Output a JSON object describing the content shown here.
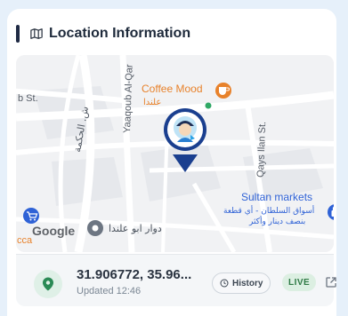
{
  "section": {
    "title": "Location Information",
    "icon": "map-icon"
  },
  "map": {
    "labels": {
      "street_a": "b St.",
      "street_b": "Yaaqoub Al-Qar",
      "street_c": "Qays Ilan St.",
      "street_d": "ش. الحكمة",
      "coffee_name": "Coffee Mood",
      "coffee_ar": "علندا",
      "sultan_name": "Sultan markets",
      "sultan_ar1": "أسواق السلطان - أي قطعة",
      "sultan_ar2": "بنصف دينار وأكثر",
      "roundabout": "دوار ابو علندا",
      "google": "Google",
      "cca": "cca"
    },
    "icons": [
      "coffee-icon",
      "shopping-bag-icon",
      "cart-icon",
      "place-icon",
      "location-marker-icon",
      "avatar"
    ]
  },
  "info": {
    "coordinates": "31.906772, 35.96...",
    "updated": "Updated 12:46",
    "history_label": "History",
    "live_label": "LIVE"
  },
  "colors": {
    "accent": "#1f2a44",
    "marker": "#1a3f8f",
    "live_bg": "#dcefe2",
    "live_text": "#2f7a45",
    "coffee": "#e8822b",
    "sultan": "#2f62d6"
  }
}
